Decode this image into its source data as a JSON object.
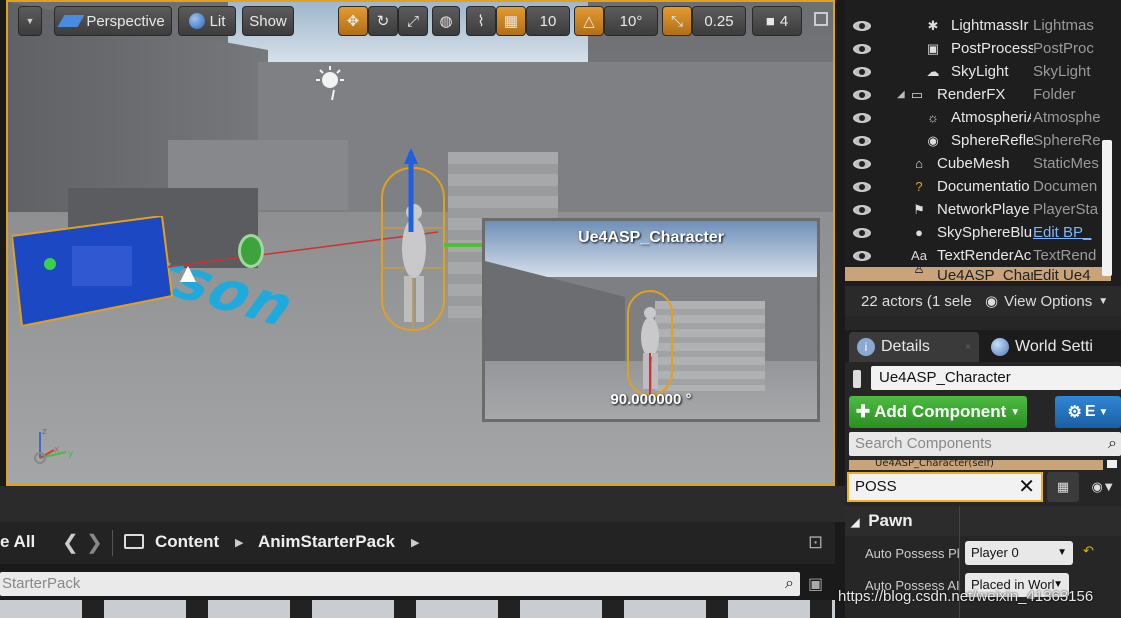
{
  "viewport": {
    "toolbar": {
      "perspective_label": "Perspective",
      "lit_label": "Lit",
      "show_label": "Show",
      "grid_snap_value": "10",
      "rotation_snap_value": "10°",
      "scale_snap_value": "0.25",
      "camera_speed_value": "4"
    },
    "scene_text": "erson",
    "preview": {
      "title": "Ue4ASP_Character",
      "angle": "90.000000 °"
    }
  },
  "outliner": {
    "rows": [
      {
        "name": "LightmassIr",
        "type": "Lightmas",
        "icon": "lightmass-icon"
      },
      {
        "name": "PostProcess",
        "type": "PostProc",
        "icon": "postprocess-icon"
      },
      {
        "name": "SkyLight",
        "type": "SkyLight",
        "icon": "skylight-icon"
      },
      {
        "name": "RenderFX",
        "type": "Folder",
        "icon": "folder-icon"
      },
      {
        "name": "AtmospheriAtmospher",
        "type": "Atmosphe",
        "icon": "atmosphere-icon"
      },
      {
        "name": "SphereRefle",
        "type": "SphereRe",
        "icon": "sphere-reflection-icon"
      },
      {
        "name": "CubeMesh",
        "type": "StaticMes",
        "icon": "static-mesh-icon"
      },
      {
        "name": "Documentatio",
        "type": "Documen",
        "icon": "documentation-icon"
      },
      {
        "name": "NetworkPlaye",
        "type": "PlayerSta",
        "icon": "player-start-icon"
      },
      {
        "name": "SkySphereBlu",
        "type": "Edit BP_",
        "icon": "sky-sphere-icon"
      },
      {
        "name": "TextRenderAc",
        "type": "TextRend",
        "icon": "text-render-icon"
      },
      {
        "name": "Ue4ASP_Char",
        "type": "Edit Ue4",
        "icon": "character-icon"
      }
    ],
    "status": "22 actors (1 sele",
    "view_options": "View Options"
  },
  "details": {
    "tab_details": "Details",
    "tab_world": "World Setti",
    "actor_name": "Ue4ASP_Character",
    "add_component": "Add Component",
    "blueprint_label": "E",
    "search_placeholder": "Search Components",
    "component_row": "Ue4ASP_Character(self)",
    "filter_value": "POSS",
    "category": "Pawn",
    "props": [
      {
        "label": "Auto Possess Pla",
        "value": "Player 0"
      },
      {
        "label": "Auto Possess AI",
        "value": "Placed in Worl"
      }
    ]
  },
  "content_browser": {
    "save_all": "e All",
    "path": [
      "Content",
      "AnimStarterPack"
    ],
    "search_value": "StarterPack"
  },
  "watermark": "https://blog.csdn.net/weixin_41363156",
  "colors": {
    "selection_orange": "#e0a020",
    "add_component_green": "#3aa82f",
    "blueprint_blue": "#2475c2",
    "scene_text_blue": "#1eaadc"
  }
}
